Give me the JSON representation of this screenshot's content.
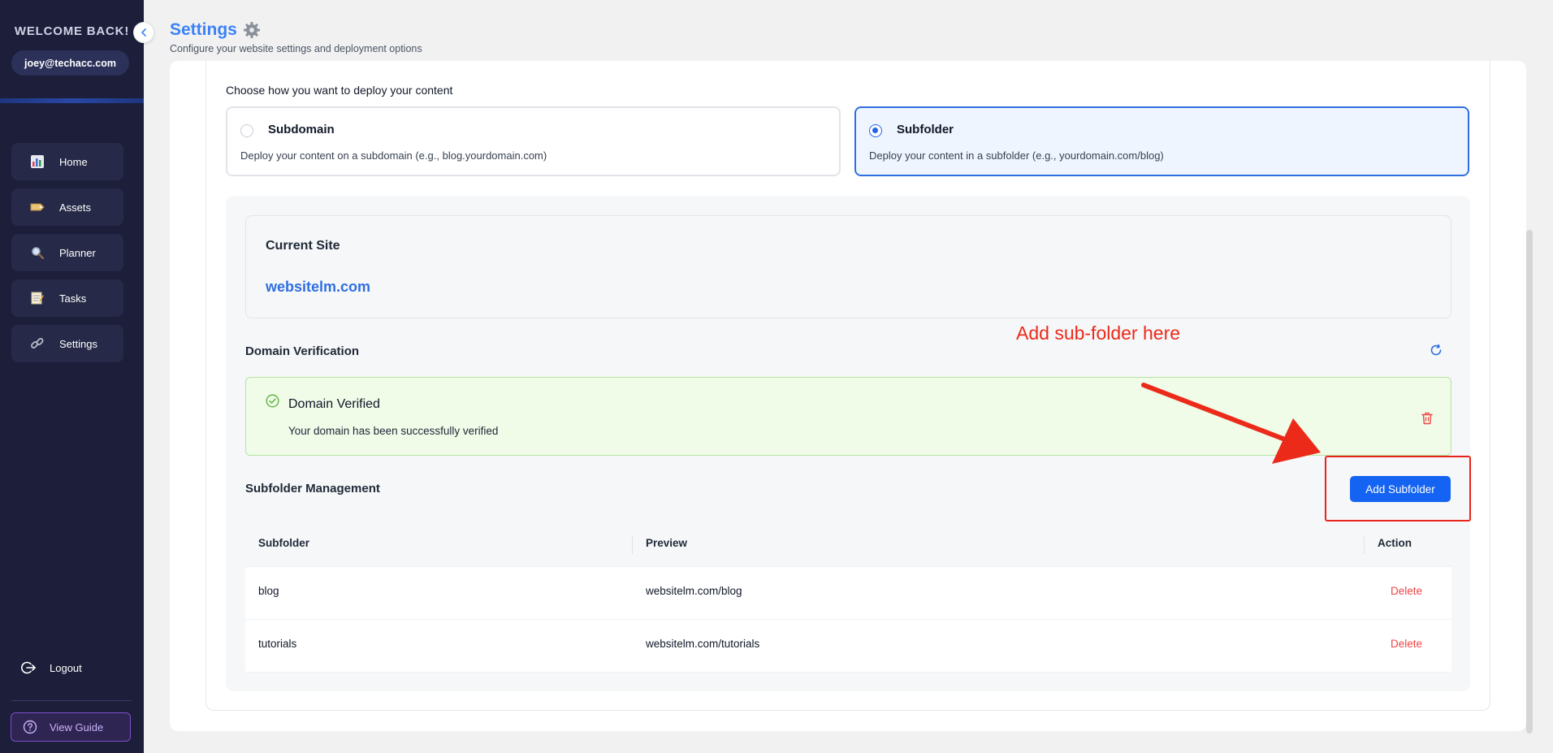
{
  "sidebar": {
    "welcome": "WELCOME BACK!",
    "email": "joey@techacc.com",
    "items": [
      {
        "label": "Home",
        "icon": "chart-icon"
      },
      {
        "label": "Assets",
        "icon": "ticket-icon"
      },
      {
        "label": "Planner",
        "icon": "magnifier-icon"
      },
      {
        "label": "Tasks",
        "icon": "memo-icon"
      },
      {
        "label": "Settings",
        "icon": "link-icon"
      }
    ],
    "logout": "Logout",
    "view_guide": "View Guide"
  },
  "header": {
    "title": "Settings",
    "subtitle": "Configure your website settings and deployment options"
  },
  "deploy": {
    "label": "Choose how you want to deploy your content",
    "options": [
      {
        "title": "Subdomain",
        "description": "Deploy your content on a subdomain (e.g., blog.yourdomain.com)",
        "selected": false
      },
      {
        "title": "Subfolder",
        "description": "Deploy your content in a subfolder (e.g., yourdomain.com/blog)",
        "selected": true
      }
    ]
  },
  "current_site": {
    "label": "Current Site",
    "domain": "websitelm.com"
  },
  "verification": {
    "title": "Domain Verification",
    "status_title": "Domain Verified",
    "status_desc": "Your domain has been successfully verified"
  },
  "subfolders": {
    "title": "Subfolder Management",
    "add_button": "Add Subfolder",
    "columns": [
      "Subfolder",
      "Preview",
      "Action"
    ],
    "rows": [
      {
        "subfolder": "blog",
        "preview": "websitelm.com/blog",
        "action": "Delete"
      },
      {
        "subfolder": "tutorials",
        "preview": "websitelm.com/tutorials",
        "action": "Delete"
      }
    ]
  },
  "annotation": {
    "text": "Add sub-folder here",
    "color": "#ec2a1a"
  },
  "colors": {
    "sidebar_bg": "#1c1e3a",
    "accent": "#1463f3",
    "title_blue": "#3b82f6",
    "danger": "#ef4444",
    "success_bg": "#f0fbe8"
  }
}
